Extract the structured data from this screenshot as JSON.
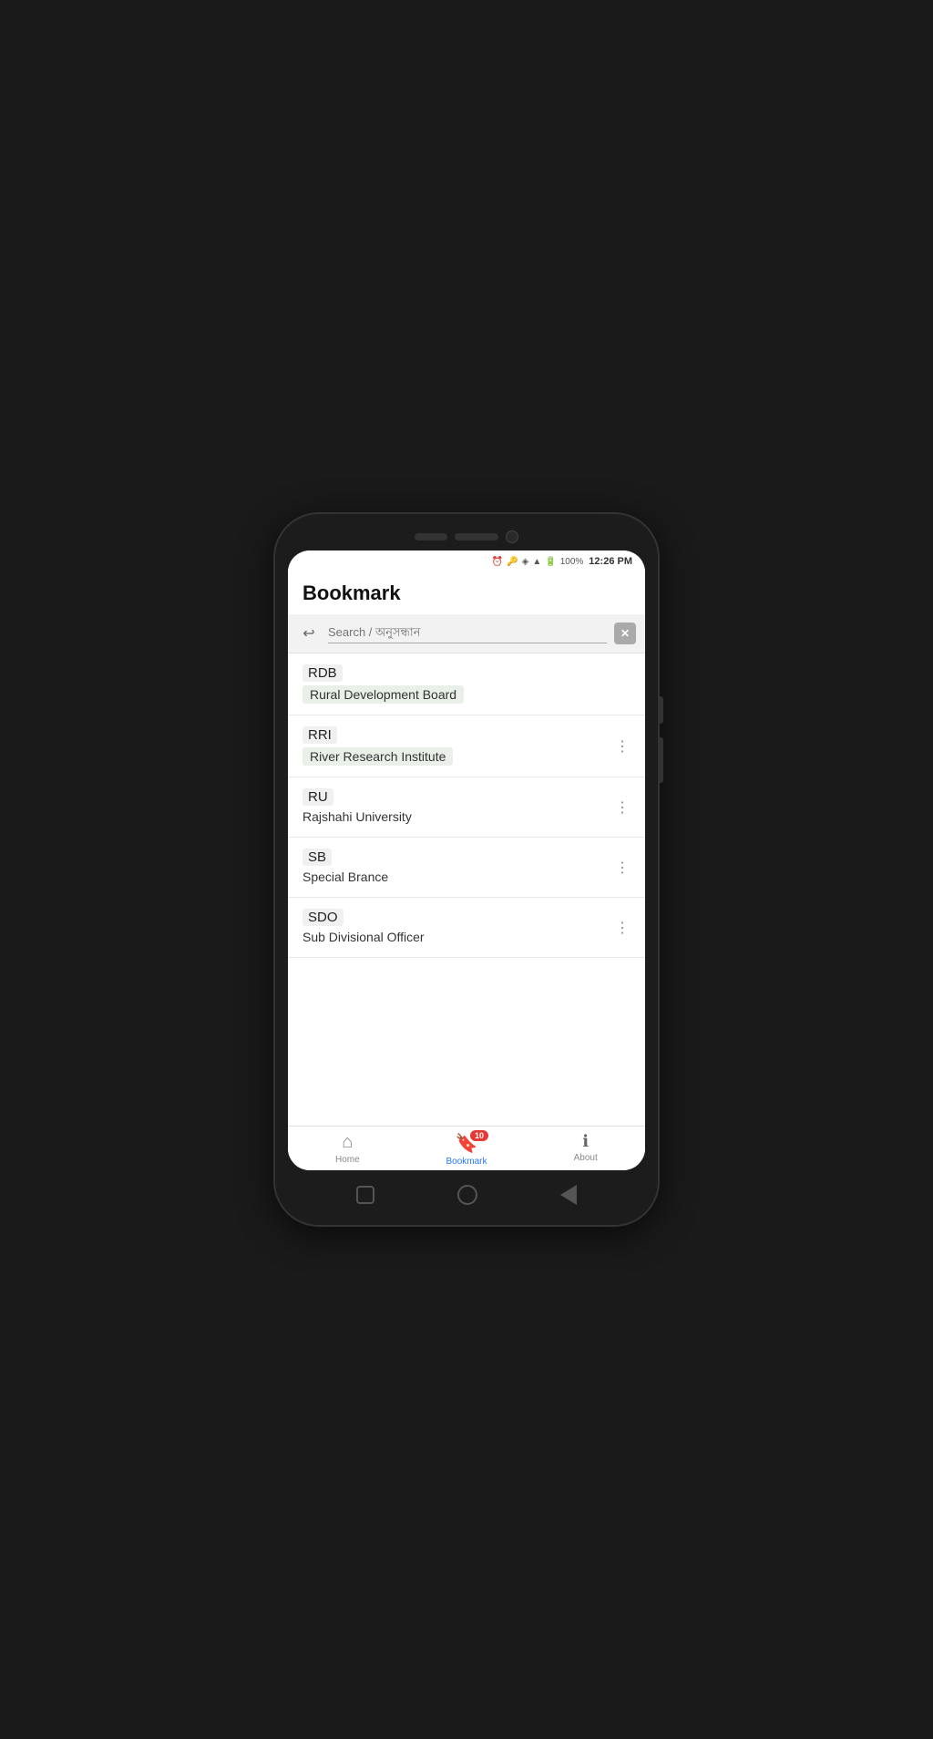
{
  "status": {
    "time": "12:26 PM",
    "battery": "100%"
  },
  "header": {
    "title": "Bookmark"
  },
  "search": {
    "placeholder": "Search / অনুসন্ধান"
  },
  "list_items": [
    {
      "abbr": "RDB",
      "full": "Rural Development Board",
      "has_menu": false,
      "full_bg": true
    },
    {
      "abbr": "RRI",
      "full": "River Research Institute",
      "has_menu": true,
      "full_bg": true
    },
    {
      "abbr": "RU",
      "full": "Rajshahi University",
      "has_menu": true,
      "full_bg": false
    },
    {
      "abbr": "SB",
      "full": "Special Brance",
      "has_menu": true,
      "full_bg": false
    },
    {
      "abbr": "SDO",
      "full": "Sub Divisional Officer",
      "has_menu": true,
      "full_bg": false
    }
  ],
  "bottom_nav": {
    "items": [
      {
        "label": "Home",
        "icon": "🏠",
        "active": false,
        "badge": null
      },
      {
        "label": "Bookmark",
        "icon": "🔖",
        "active": true,
        "badge": "10"
      },
      {
        "label": "About",
        "icon": "ℹ",
        "active": false,
        "badge": null
      }
    ]
  }
}
